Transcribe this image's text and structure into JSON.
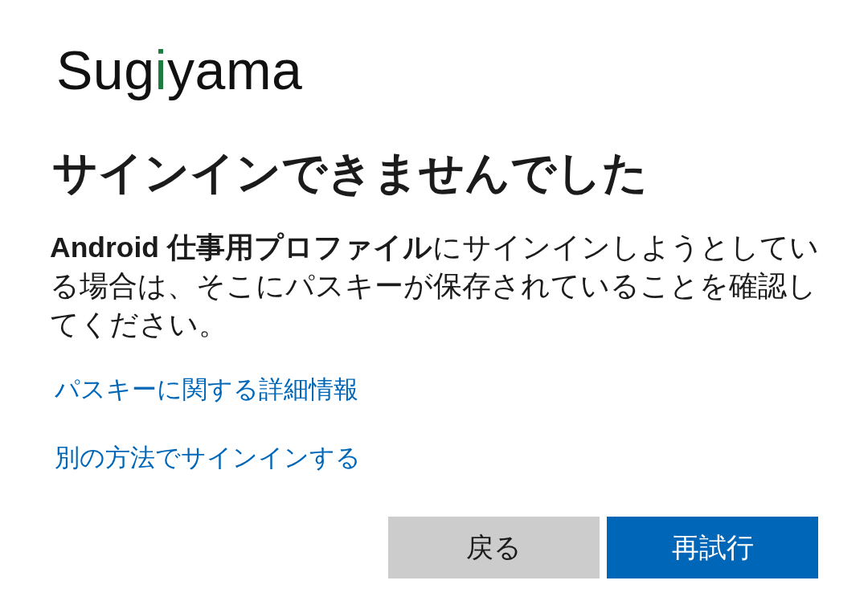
{
  "logo": {
    "text_before": "Sug",
    "accent": "i",
    "text_after": "yama"
  },
  "title": "サインインできませんでした",
  "message": "**Android 仕事用プロファイル**にサインインしようとしている場合は、そこにパスキーが保存されていることを確認してください。",
  "links": [
    "パスキーに関する詳細情報",
    "別の方法でサインインする"
  ],
  "buttons": [
    {
      "label": "戻る",
      "kind": "secondary"
    },
    {
      "label": "再試行",
      "kind": "primary"
    }
  ]
}
